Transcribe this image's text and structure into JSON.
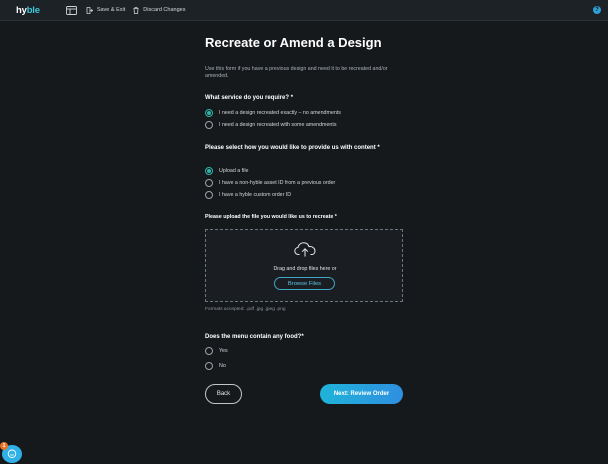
{
  "header": {
    "logo_main": "hy",
    "logo_accent": "ble",
    "save_exit_label": "Save & Exit",
    "discard_label": "Discard Changes",
    "help_label": "?"
  },
  "form": {
    "title": "Recreate or Amend a Design",
    "description": "Use this form if you have a previous design and need it to be recreated and/or amended.",
    "service_question": "What service do you require? *",
    "service_options": [
      {
        "label": "I need a design recreated exactly – no amendments",
        "selected": true
      },
      {
        "label": "I need a design recreated with some amendments",
        "selected": false
      }
    ],
    "content_question": "Please select how you would like to provide us with content *",
    "content_options": [
      {
        "label": "Upload a file",
        "selected": true
      },
      {
        "label": "I have a non-hyble asset ID from a previous order",
        "selected": false
      },
      {
        "label": "I have a hyble custom order ID",
        "selected": false
      }
    ],
    "upload_label": "Please upload the file you would like us to recreate *",
    "drop_text": "Drag and drop files here or",
    "browse_label": "Browse Files",
    "formats": "Formats accepted: .pdf .jpg .jpeg .png",
    "food_question": "Does the menu contain any food?*",
    "food_options": [
      {
        "label": "Yes",
        "selected": false
      },
      {
        "label": "No",
        "selected": false
      }
    ],
    "back_label": "Back",
    "next_label": "Next: Review Order"
  },
  "chat": {
    "badge_count": "1"
  },
  "colors": {
    "background": "#16191c",
    "accent_teal": "#2fb5a9",
    "primary_blue": "#2f8fe0"
  }
}
